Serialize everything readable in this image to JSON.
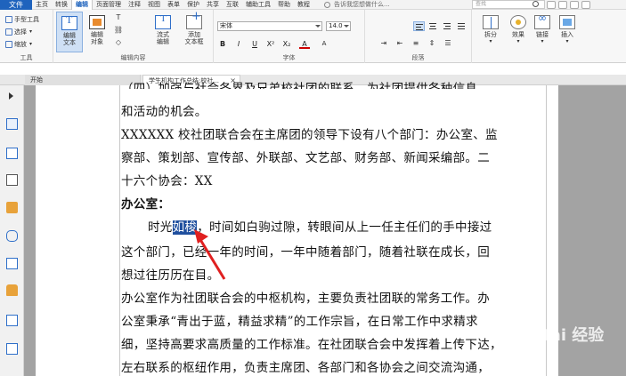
{
  "menubar": {
    "file": "文件",
    "items": [
      "主页",
      "转换",
      "编辑",
      "页面管理",
      "注释",
      "视图",
      "表单",
      "保护",
      "共享",
      "互联",
      "辅助工具",
      "帮助",
      "教程"
    ],
    "active_index": 2,
    "help_prompt": "告诉我您想做什么...",
    "search_placeholder": "查找"
  },
  "ribbon": {
    "tools_group": {
      "label": "工具",
      "items": [
        "手型工具",
        "选择",
        "缩放"
      ]
    },
    "edit_content_group": {
      "label": "编辑内容",
      "edit_text": "编辑\n文本",
      "edit_object": "编辑\n对象",
      "flow_text": "流式\n编辑",
      "add_text": "添加\n文本框"
    },
    "font_group": {
      "label": "字体",
      "font_name": "宋体",
      "font_size": "14.0",
      "buttons": [
        "B",
        "I",
        "U",
        "X²",
        "X₂",
        "A",
        "A"
      ]
    },
    "paragraph_group": {
      "label": "段落"
    },
    "right_buttons": [
      {
        "label": "拆分"
      },
      {
        "label": "效果"
      },
      {
        "label": "链接"
      },
      {
        "label": "插入"
      }
    ]
  },
  "tabs": {
    "home": "开始",
    "current": "学生机构工作总结;校社...",
    "close": "×"
  },
  "document": {
    "lines": [
      "（四）加强与社会各界及兄弟校社团的联系，为社团提供各种信息",
      "和活动的机会。",
      "XXXXXX 校社团联合会在主席团的领导下设有八个部门：办公室、监",
      "察部、策划部、宣传部、外联部、文艺部、财务部、新闻采编部。二",
      "十六个协会：XX",
      "办公室：",
      "这个部门，已经一年的时间，一年中随着部门，随着社联在成长，回",
      "想过往历历在目。",
      "办公室作为社团联合会的中枢机构，主要负责社团联的常务工作。办",
      "公室秉承“青出于蓝，精益求精”的工作宗旨，在日常工作中求精求",
      "细，坚持高要求高质量的工作标准。在社团联合会中发挥着上传下达，",
      "左右联系的枢纽作用，负责主席团、各部门和各协会之间交流沟通，"
    ],
    "para_line": {
      "before": "时光",
      "selected": "如梭",
      "after": "，时间如白驹过隙，转眼间从上一任主任们的手中接过"
    }
  },
  "watermark": "Bai 经验"
}
